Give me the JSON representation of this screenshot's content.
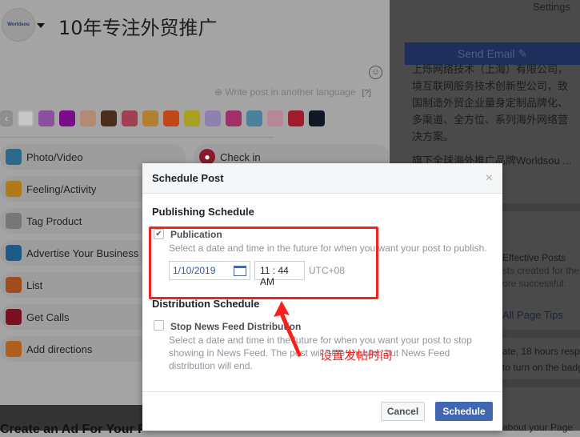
{
  "composer": {
    "page_logo": "Worldsou",
    "title": "10年专注外贸推广",
    "write_language": "Write post in another language",
    "help": "[?]",
    "swatch_colors": [
      "#c8c8c8",
      "#8a4f9e",
      "#7a0c8c",
      "#b48a74",
      "#4a2e1e",
      "#a04050",
      "#b08030",
      "#c04818",
      "#a8a020",
      "#8e80b0",
      "#a03068",
      "#4a8098",
      "#b88898",
      "#a01c2c",
      "#101828"
    ],
    "actions": [
      {
        "label": "Photo/Video",
        "icon": "photo-icon",
        "color": "#2d6a8a"
      },
      {
        "label": "Feeling/Activity",
        "icon": "smiley-icon",
        "color": "#b07a18"
      },
      {
        "label": "Tag Product",
        "icon": "tag-icon",
        "color": "#777"
      },
      {
        "label": "Advertise Your Business",
        "icon": "advertise-icon",
        "color": "#1e5a88"
      },
      {
        "label": "List",
        "icon": "list-icon",
        "color": "#a04c1c"
      },
      {
        "label": "Get Calls",
        "icon": "phone-icon",
        "color": "#7a1020"
      },
      {
        "label": "Add directions",
        "icon": "directions-icon",
        "color": "#b0601c"
      }
    ],
    "check_in": "Check in",
    "bottom_text": "Create an Ad For Your P"
  },
  "sidebar": {
    "settings": "Settings",
    "send_email": "Send Email ✎",
    "about_lines": [
      "上烁网络技术（上海）有限公司，",
      "境互联网服务技术创新型公司，致",
      "国制造外贸企业量身定制品牌化、",
      "多渠道、全方位、系列海外网络营",
      "决方案。"
    ],
    "brand_line": "旗下全球海外推广品牌Worldsou ...",
    "tips_title": "Effective Posts",
    "tips_lines": [
      "sts created for the",
      "ore successful."
    ],
    "all_tips": "All Page Tips",
    "resp_lines": [
      "ate, 18 hours respo",
      "to turn on the badg"
    ],
    "about_page": "about your Page"
  },
  "modal": {
    "title": "Schedule Post",
    "close": "×",
    "publishing_heading": "Publishing Schedule",
    "publication_label": "Publication",
    "publication_checked": true,
    "publication_desc": "Select a date and time in the future for when you want your post to publish.",
    "date": "1/10/2019",
    "time": "11 : 44 AM",
    "timezone": "UTC+08",
    "distribution_heading": "Distribution Schedule",
    "stop_label": "Stop News Feed Distribution",
    "stop_checked": false,
    "stop_desc": "Select a date and time in the future for when you want your post to stop showing in News Feed. The post will stop showing but News Feed distribution will end.",
    "cancel": "Cancel",
    "schedule": "Schedule"
  },
  "annotation": {
    "text": "设置发帖时间",
    "color": "#f5211d"
  }
}
